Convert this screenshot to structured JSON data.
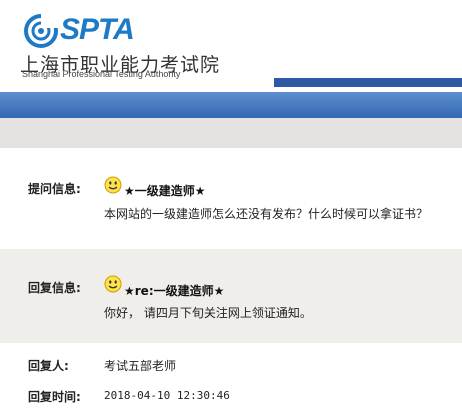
{
  "header": {
    "logo_text": "SPTA",
    "org_name_cn": "上海市职业能力考试院",
    "org_name_en": "Shanghai Professional Testing Authority"
  },
  "question": {
    "label": "提问信息:",
    "title": "★一级建造师★",
    "content": "本网站的一级建造师怎么还没有发布？什么时候可以拿证书？"
  },
  "reply": {
    "label": "回复信息:",
    "title": "★re:一级建造师★",
    "content": "你好， 请四月下旬关注网上领证通知。"
  },
  "replier": {
    "label": "回复人:",
    "value": "考试五部老师"
  },
  "reply_time": {
    "label": "回复时间:",
    "value": "2018-04-10 12:30:46"
  },
  "colors": {
    "brand_blue": "#1d7ac6",
    "band_blue": "#3567b3",
    "shade": "#efeeea"
  }
}
